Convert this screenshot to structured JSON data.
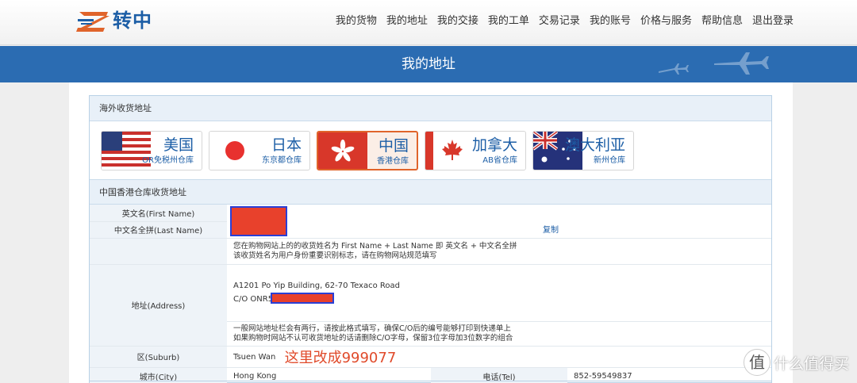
{
  "brand": {
    "name": "转中"
  },
  "nav": [
    "我的货物",
    "我的地址",
    "我的交接",
    "我的工单",
    "交易记录",
    "我的账号",
    "价格与服务",
    "帮助信息",
    "退出登录"
  ],
  "banner": {
    "title": "我的地址"
  },
  "overseas": {
    "title": "海外收货地址"
  },
  "warehouses": [
    {
      "name": "美国",
      "sub": "OR免税州仓库",
      "active": false
    },
    {
      "name": "日本",
      "sub": "东京都仓库",
      "active": false
    },
    {
      "name": "中国",
      "sub": "香港仓库",
      "active": true
    },
    {
      "name": "加拿大",
      "sub": "AB省仓库",
      "active": false
    },
    {
      "name": "澳大利亚",
      "sub": "新州仓库",
      "active": false
    }
  ],
  "section": {
    "title": "中国香港仓库收货地址"
  },
  "form": {
    "first_name_label": "英文名(First Name)",
    "last_name_label": "中文名全拼(Last Name)",
    "copy": "复制",
    "name_note_1": "您在购物网站上的的收货姓名为 First Name + Last Name 即 英文名 + 中文名全拼",
    "name_note_2": "该收货姓名为用户身份重要识别标志，请在购物网站规范填写",
    "address_label": "地址(Address)",
    "address_line1": "A1201 Po Yip Building, 62-70 Texaco Road",
    "address_line2": "C/O ONR5",
    "address_note_1": "一般网站地址栏会有两行，请按此格式填写，确保C/O后的编号能够打印到快递单上",
    "address_note_2": "如果购物时网站不认可收货地址的话请删除C/O字母，保留3位字母加3位数字的组合",
    "suburb_label": "区(Suburb)",
    "suburb_value": "Tsuen Wan",
    "suburb_annotation": "这里改成999077",
    "city_label": "城市(City)",
    "city_value": "Hong Kong",
    "tel_label": "电话(Tel)",
    "tel_value": "852-59549837"
  },
  "watermark": {
    "icon": "值",
    "text": "什么值得买"
  }
}
